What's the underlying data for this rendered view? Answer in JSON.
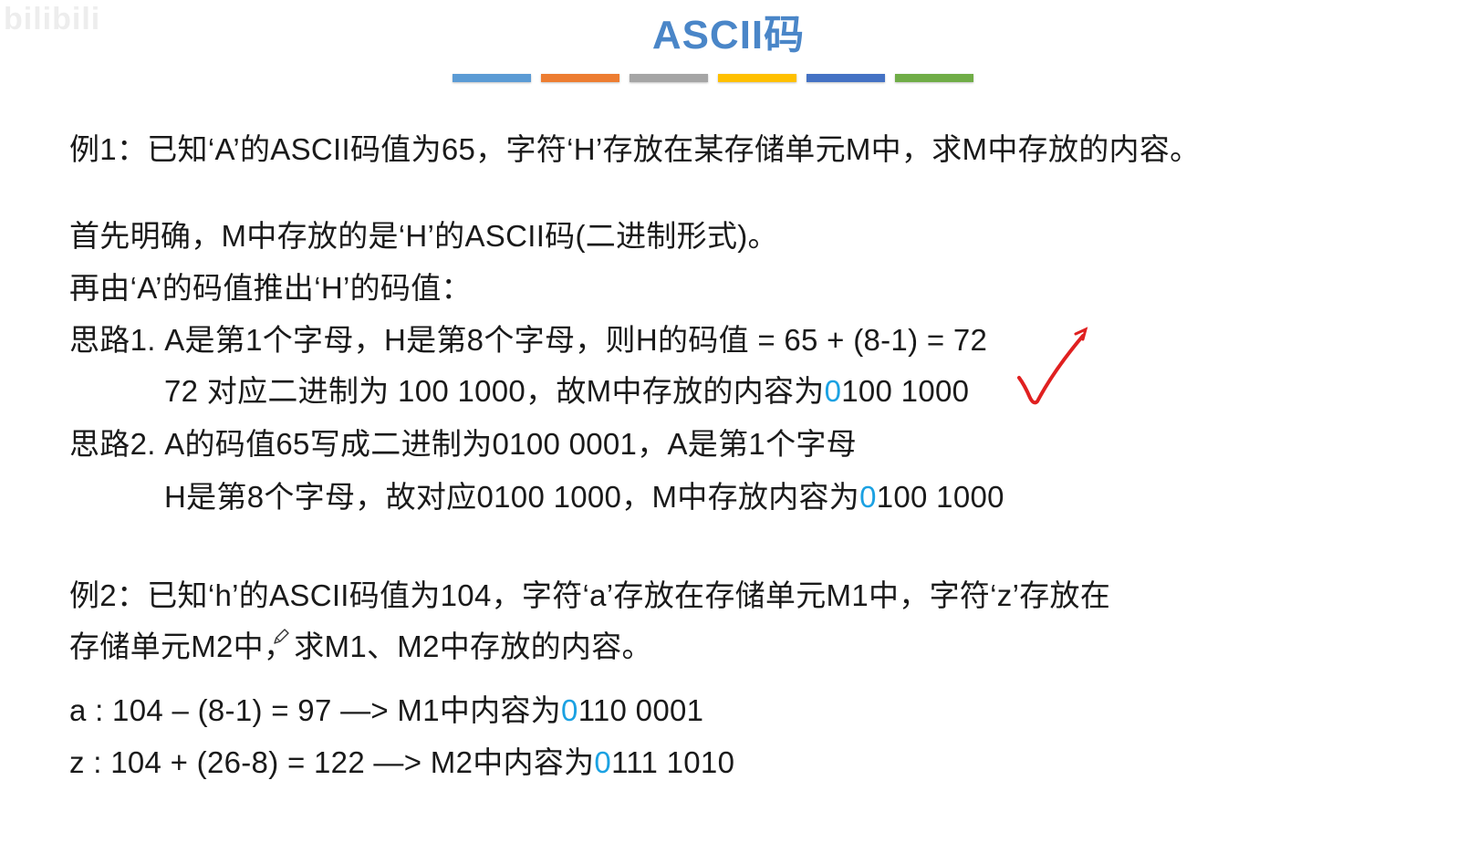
{
  "watermark": "bilibili",
  "title": "ASCII码",
  "title_color": "#4a86c8",
  "highlight_color": "#1ba1e2",
  "bars": [
    {
      "color": "#5b9bd5"
    },
    {
      "color": "#ed7d31"
    },
    {
      "color": "#a5a5a5"
    },
    {
      "color": "#ffc000"
    },
    {
      "color": "#4472c4"
    },
    {
      "color": "#70ad47"
    }
  ],
  "ex1": {
    "question": "例1：已知‘A’的ASCII码值为65，字符‘H’存放在某存储单元M中，求M中存放的内容。",
    "step1": "首先明确，M中存放的是‘H’的ASCII码(二进制形式)。",
    "step2": "再由‘A’的码值推出‘H’的码值：",
    "idea1_line1": "思路1. A是第1个字母，H是第8个字母，则H的码值 = 65 + (8-1)  = 72",
    "idea1_line2_prefix": "72 对应二进制为 100 1000，故M中存放的内容为",
    "idea1_line2_hl": "0",
    "idea1_line2_suffix": "100 1000",
    "idea2_line1": "思路2. A的码值65写成二进制为0100 0001，A是第1个字母",
    "idea2_line2_prefix": "H是第8个字母，故对应0100 1000，M中存放内容为",
    "idea2_line2_hl": "0",
    "idea2_line2_suffix": "100 1000"
  },
  "ex2": {
    "question_line1": "例2：已知‘h’的ASCII码值为104，字符‘a’存放在存储单元M1中，字符‘z’存放在",
    "question_line2": "存储单元M2中，求M1、M2中存放的内容。",
    "a_prefix": "a : 104 – (8-1) = 97  —> M1中内容为",
    "a_hl": "0",
    "a_suffix": "110 0001",
    "z_prefix": "z : 104 + (26-8) = 122 —> M2中内容为",
    "z_hl": "0",
    "z_suffix": "111 1010"
  },
  "icons": {
    "checkmark": "checkmark-icon",
    "pencil": "pencil-cursor-icon"
  }
}
